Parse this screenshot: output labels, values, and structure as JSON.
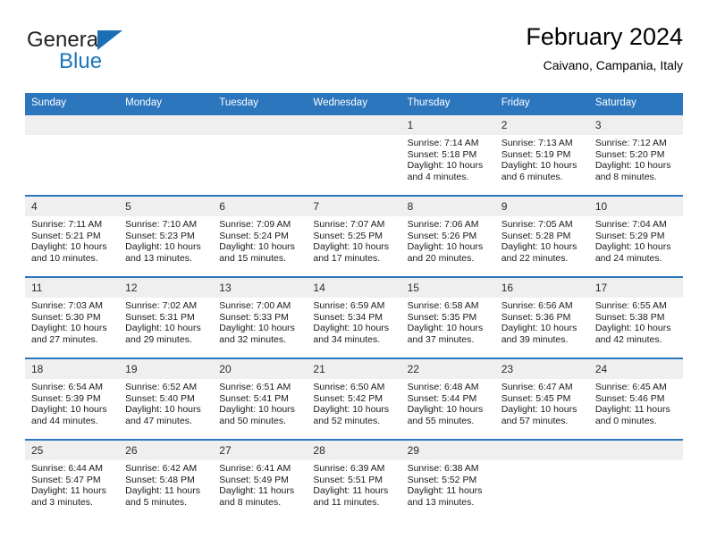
{
  "brand": {
    "word1": "General",
    "word2": "Blue",
    "triangle_color": "#1b6fb5",
    "blue_color": "#1b75bb"
  },
  "header": {
    "title": "February 2024",
    "subtitle": "Caivano, Campania, Italy",
    "accent_color": "#2c76bd",
    "band_color": "#efefef"
  },
  "weekdays": [
    "Sunday",
    "Monday",
    "Tuesday",
    "Wednesday",
    "Thursday",
    "Friday",
    "Saturday"
  ],
  "labels": {
    "sunrise": "Sunrise:",
    "sunset": "Sunset:",
    "daylight": "Daylight:"
  },
  "weeks": [
    [
      {
        "day": "",
        "empty": true
      },
      {
        "day": "",
        "empty": true
      },
      {
        "day": "",
        "empty": true
      },
      {
        "day": "",
        "empty": true
      },
      {
        "day": "1",
        "sunrise": "Sunrise: 7:14 AM",
        "sunset": "Sunset: 5:18 PM",
        "daylight": "Daylight: 10 hours and 4 minutes."
      },
      {
        "day": "2",
        "sunrise": "Sunrise: 7:13 AM",
        "sunset": "Sunset: 5:19 PM",
        "daylight": "Daylight: 10 hours and 6 minutes."
      },
      {
        "day": "3",
        "sunrise": "Sunrise: 7:12 AM",
        "sunset": "Sunset: 5:20 PM",
        "daylight": "Daylight: 10 hours and 8 minutes."
      }
    ],
    [
      {
        "day": "4",
        "sunrise": "Sunrise: 7:11 AM",
        "sunset": "Sunset: 5:21 PM",
        "daylight": "Daylight: 10 hours and 10 minutes."
      },
      {
        "day": "5",
        "sunrise": "Sunrise: 7:10 AM",
        "sunset": "Sunset: 5:23 PM",
        "daylight": "Daylight: 10 hours and 13 minutes."
      },
      {
        "day": "6",
        "sunrise": "Sunrise: 7:09 AM",
        "sunset": "Sunset: 5:24 PM",
        "daylight": "Daylight: 10 hours and 15 minutes."
      },
      {
        "day": "7",
        "sunrise": "Sunrise: 7:07 AM",
        "sunset": "Sunset: 5:25 PM",
        "daylight": "Daylight: 10 hours and 17 minutes."
      },
      {
        "day": "8",
        "sunrise": "Sunrise: 7:06 AM",
        "sunset": "Sunset: 5:26 PM",
        "daylight": "Daylight: 10 hours and 20 minutes."
      },
      {
        "day": "9",
        "sunrise": "Sunrise: 7:05 AM",
        "sunset": "Sunset: 5:28 PM",
        "daylight": "Daylight: 10 hours and 22 minutes."
      },
      {
        "day": "10",
        "sunrise": "Sunrise: 7:04 AM",
        "sunset": "Sunset: 5:29 PM",
        "daylight": "Daylight: 10 hours and 24 minutes."
      }
    ],
    [
      {
        "day": "11",
        "sunrise": "Sunrise: 7:03 AM",
        "sunset": "Sunset: 5:30 PM",
        "daylight": "Daylight: 10 hours and 27 minutes."
      },
      {
        "day": "12",
        "sunrise": "Sunrise: 7:02 AM",
        "sunset": "Sunset: 5:31 PM",
        "daylight": "Daylight: 10 hours and 29 minutes."
      },
      {
        "day": "13",
        "sunrise": "Sunrise: 7:00 AM",
        "sunset": "Sunset: 5:33 PM",
        "daylight": "Daylight: 10 hours and 32 minutes."
      },
      {
        "day": "14",
        "sunrise": "Sunrise: 6:59 AM",
        "sunset": "Sunset: 5:34 PM",
        "daylight": "Daylight: 10 hours and 34 minutes."
      },
      {
        "day": "15",
        "sunrise": "Sunrise: 6:58 AM",
        "sunset": "Sunset: 5:35 PM",
        "daylight": "Daylight: 10 hours and 37 minutes."
      },
      {
        "day": "16",
        "sunrise": "Sunrise: 6:56 AM",
        "sunset": "Sunset: 5:36 PM",
        "daylight": "Daylight: 10 hours and 39 minutes."
      },
      {
        "day": "17",
        "sunrise": "Sunrise: 6:55 AM",
        "sunset": "Sunset: 5:38 PM",
        "daylight": "Daylight: 10 hours and 42 minutes."
      }
    ],
    [
      {
        "day": "18",
        "sunrise": "Sunrise: 6:54 AM",
        "sunset": "Sunset: 5:39 PM",
        "daylight": "Daylight: 10 hours and 44 minutes."
      },
      {
        "day": "19",
        "sunrise": "Sunrise: 6:52 AM",
        "sunset": "Sunset: 5:40 PM",
        "daylight": "Daylight: 10 hours and 47 minutes."
      },
      {
        "day": "20",
        "sunrise": "Sunrise: 6:51 AM",
        "sunset": "Sunset: 5:41 PM",
        "daylight": "Daylight: 10 hours and 50 minutes."
      },
      {
        "day": "21",
        "sunrise": "Sunrise: 6:50 AM",
        "sunset": "Sunset: 5:42 PM",
        "daylight": "Daylight: 10 hours and 52 minutes."
      },
      {
        "day": "22",
        "sunrise": "Sunrise: 6:48 AM",
        "sunset": "Sunset: 5:44 PM",
        "daylight": "Daylight: 10 hours and 55 minutes."
      },
      {
        "day": "23",
        "sunrise": "Sunrise: 6:47 AM",
        "sunset": "Sunset: 5:45 PM",
        "daylight": "Daylight: 10 hours and 57 minutes."
      },
      {
        "day": "24",
        "sunrise": "Sunrise: 6:45 AM",
        "sunset": "Sunset: 5:46 PM",
        "daylight": "Daylight: 11 hours and 0 minutes."
      }
    ],
    [
      {
        "day": "25",
        "sunrise": "Sunrise: 6:44 AM",
        "sunset": "Sunset: 5:47 PM",
        "daylight": "Daylight: 11 hours and 3 minutes."
      },
      {
        "day": "26",
        "sunrise": "Sunrise: 6:42 AM",
        "sunset": "Sunset: 5:48 PM",
        "daylight": "Daylight: 11 hours and 5 minutes."
      },
      {
        "day": "27",
        "sunrise": "Sunrise: 6:41 AM",
        "sunset": "Sunset: 5:49 PM",
        "daylight": "Daylight: 11 hours and 8 minutes."
      },
      {
        "day": "28",
        "sunrise": "Sunrise: 6:39 AM",
        "sunset": "Sunset: 5:51 PM",
        "daylight": "Daylight: 11 hours and 11 minutes."
      },
      {
        "day": "29",
        "sunrise": "Sunrise: 6:38 AM",
        "sunset": "Sunset: 5:52 PM",
        "daylight": "Daylight: 11 hours and 13 minutes."
      },
      {
        "day": "",
        "empty": true
      },
      {
        "day": "",
        "empty": true
      }
    ]
  ]
}
